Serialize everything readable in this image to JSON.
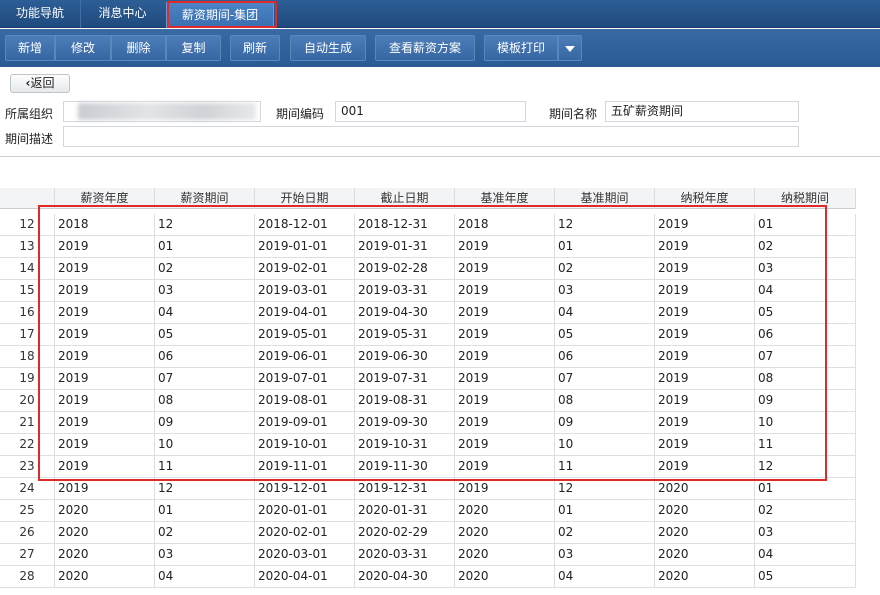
{
  "tabs": [
    {
      "label": "功能导航"
    },
    {
      "label": "消息中心"
    },
    {
      "label": "薪资期间-集团"
    }
  ],
  "toolbar": {
    "add": "新增",
    "edit": "修改",
    "delete": "删除",
    "copy": "复制",
    "refresh": "刷新",
    "autogen": "自动生成",
    "view_plan": "查看薪资方案",
    "print": "模板打印"
  },
  "back_label": "返回",
  "form": {
    "org_label": "所属组织",
    "code_label": "期间编码",
    "code_value": "001",
    "name_label": "期间名称",
    "name_value": "五矿薪资期间",
    "desc_label": "期间描述",
    "desc_value": ""
  },
  "columns": [
    "薪资年度",
    "薪资期间",
    "开始日期",
    "截止日期",
    "基准年度",
    "基准期间",
    "纳税年度",
    "纳税期间"
  ],
  "rows": [
    {
      "n": "12",
      "c": [
        "2018",
        "12",
        "2018-12-01",
        "2018-12-31",
        "2018",
        "12",
        "2019",
        "01"
      ]
    },
    {
      "n": "13",
      "c": [
        "2019",
        "01",
        "2019-01-01",
        "2019-01-31",
        "2019",
        "01",
        "2019",
        "02"
      ]
    },
    {
      "n": "14",
      "c": [
        "2019",
        "02",
        "2019-02-01",
        "2019-02-28",
        "2019",
        "02",
        "2019",
        "03"
      ]
    },
    {
      "n": "15",
      "c": [
        "2019",
        "03",
        "2019-03-01",
        "2019-03-31",
        "2019",
        "03",
        "2019",
        "04"
      ]
    },
    {
      "n": "16",
      "c": [
        "2019",
        "04",
        "2019-04-01",
        "2019-04-30",
        "2019",
        "04",
        "2019",
        "05"
      ]
    },
    {
      "n": "17",
      "c": [
        "2019",
        "05",
        "2019-05-01",
        "2019-05-31",
        "2019",
        "05",
        "2019",
        "06"
      ]
    },
    {
      "n": "18",
      "c": [
        "2019",
        "06",
        "2019-06-01",
        "2019-06-30",
        "2019",
        "06",
        "2019",
        "07"
      ]
    },
    {
      "n": "19",
      "c": [
        "2019",
        "07",
        "2019-07-01",
        "2019-07-31",
        "2019",
        "07",
        "2019",
        "08"
      ]
    },
    {
      "n": "20",
      "c": [
        "2019",
        "08",
        "2019-08-01",
        "2019-08-31",
        "2019",
        "08",
        "2019",
        "09"
      ]
    },
    {
      "n": "21",
      "c": [
        "2019",
        "09",
        "2019-09-01",
        "2019-09-30",
        "2019",
        "09",
        "2019",
        "10"
      ]
    },
    {
      "n": "22",
      "c": [
        "2019",
        "10",
        "2019-10-01",
        "2019-10-31",
        "2019",
        "10",
        "2019",
        "11"
      ]
    },
    {
      "n": "23",
      "c": [
        "2019",
        "11",
        "2019-11-01",
        "2019-11-30",
        "2019",
        "11",
        "2019",
        "12"
      ]
    },
    {
      "n": "24",
      "c": [
        "2019",
        "12",
        "2019-12-01",
        "2019-12-31",
        "2019",
        "12",
        "2020",
        "01"
      ]
    },
    {
      "n": "25",
      "c": [
        "2020",
        "01",
        "2020-01-01",
        "2020-01-31",
        "2020",
        "01",
        "2020",
        "02"
      ]
    },
    {
      "n": "26",
      "c": [
        "2020",
        "02",
        "2020-02-01",
        "2020-02-29",
        "2020",
        "02",
        "2020",
        "03"
      ]
    },
    {
      "n": "27",
      "c": [
        "2020",
        "03",
        "2020-03-01",
        "2020-03-31",
        "2020",
        "03",
        "2020",
        "04"
      ]
    },
    {
      "n": "28",
      "c": [
        "2020",
        "04",
        "2020-04-01",
        "2020-04-30",
        "2020",
        "04",
        "2020",
        "05"
      ]
    }
  ],
  "colors": {
    "header_bar": "#2d5e96",
    "highlight": "#e02a2a"
  }
}
